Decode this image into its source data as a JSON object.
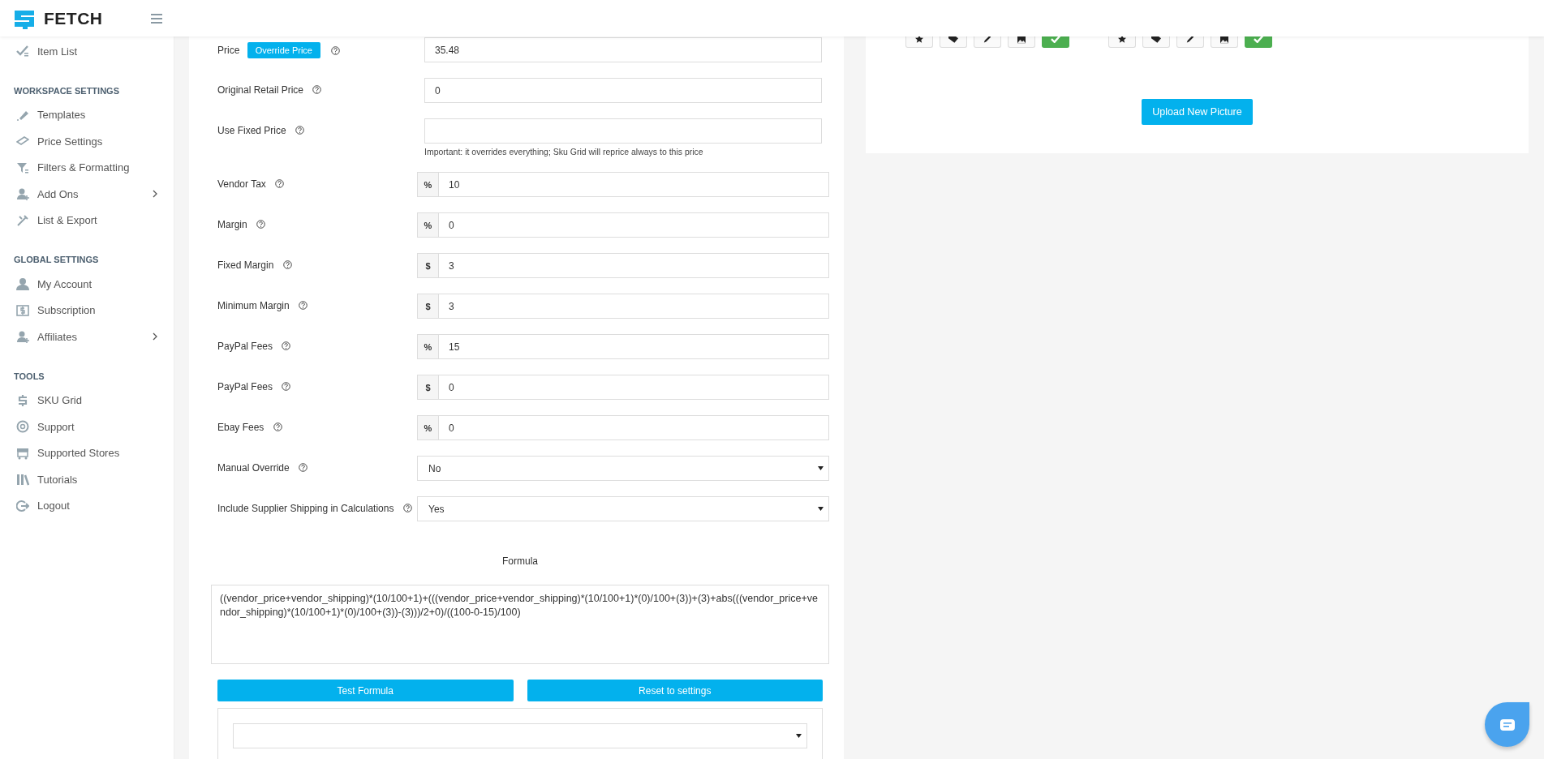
{
  "header": {
    "logo_text": "FETCH"
  },
  "sidebar": {
    "sections": [
      {
        "items": [
          {
            "label": "Item List",
            "expandable": false
          }
        ]
      },
      {
        "heading": "WORKSPACE SETTINGS",
        "items": [
          {
            "label": "Templates",
            "expandable": false
          },
          {
            "label": "Price Settings",
            "expandable": false
          },
          {
            "label": "Filters & Formatting",
            "expandable": false
          },
          {
            "label": "Add Ons",
            "expandable": true
          },
          {
            "label": "List & Export",
            "expandable": false
          }
        ]
      },
      {
        "heading": "GLOBAL SETTINGS",
        "items": [
          {
            "label": "My Account",
            "expandable": false
          },
          {
            "label": "Subscription",
            "expandable": false
          },
          {
            "label": "Affiliates",
            "expandable": true
          }
        ]
      },
      {
        "heading": "TOOLS",
        "items": [
          {
            "label": "SKU Grid",
            "expandable": false
          },
          {
            "label": "Support",
            "expandable": false
          },
          {
            "label": "Supported Stores",
            "expandable": false
          },
          {
            "label": "Tutorials",
            "expandable": false
          },
          {
            "label": "Logout",
            "expandable": false
          }
        ]
      }
    ]
  },
  "form": {
    "fields": [
      {
        "kind": "text",
        "label": "Price",
        "button": "Override Price",
        "value": "35.48"
      },
      {
        "kind": "text",
        "label": "Original Retail Price",
        "value": "0"
      },
      {
        "kind": "text",
        "label": "Use Fixed Price",
        "note": "Important: it overrides everything; Sku Grid will reprice always to this price"
      },
      {
        "kind": "addon",
        "label": "Vendor Tax",
        "addon": "%",
        "value": "10"
      },
      {
        "kind": "addon",
        "label": "Margin",
        "addon": "%",
        "value": "0"
      },
      {
        "kind": "addon",
        "label": "Fixed Margin",
        "addon": "$",
        "value": "3"
      },
      {
        "kind": "addon",
        "label": "Minimum Margin",
        "addon": "$",
        "value": "3"
      },
      {
        "kind": "addon",
        "label": "PayPal Fees",
        "addon": "%",
        "value": "15"
      },
      {
        "kind": "addon",
        "label": "PayPal Fees",
        "addon": "$",
        "value": "0"
      },
      {
        "kind": "addon",
        "label": "Ebay Fees",
        "addon": "%",
        "value": "0"
      },
      {
        "kind": "select",
        "label": "Manual Override",
        "value": "No"
      },
      {
        "kind": "select",
        "label": "Include Supplier Shipping in Calculations",
        "value": "Yes"
      }
    ],
    "formula": {
      "label": "Formula",
      "value": "((vendor_price+vendor_shipping)*(10/100+1)+(((vendor_price+vendor_shipping)*(10/100+1)*(0)/100+(3))+(3)+abs(((vendor_price+vendor_shipping)*(10/100+1)*(0)/100+(3))-(3)))/2+0)/((100-0-15)/100)"
    },
    "buttons": [
      "Test Formula",
      "Reset to settings"
    ]
  },
  "pictures": {
    "tool_groups": [
      [
        {
          "kind": "star"
        },
        {
          "kind": "tag"
        },
        {
          "kind": "pencil"
        },
        {
          "kind": "image"
        },
        {
          "kind": "check"
        }
      ],
      [
        {
          "kind": "star"
        },
        {
          "kind": "tag"
        },
        {
          "kind": "pencil"
        },
        {
          "kind": "image"
        },
        {
          "kind": "check"
        }
      ]
    ],
    "upload_button": "Upload New Picture"
  }
}
